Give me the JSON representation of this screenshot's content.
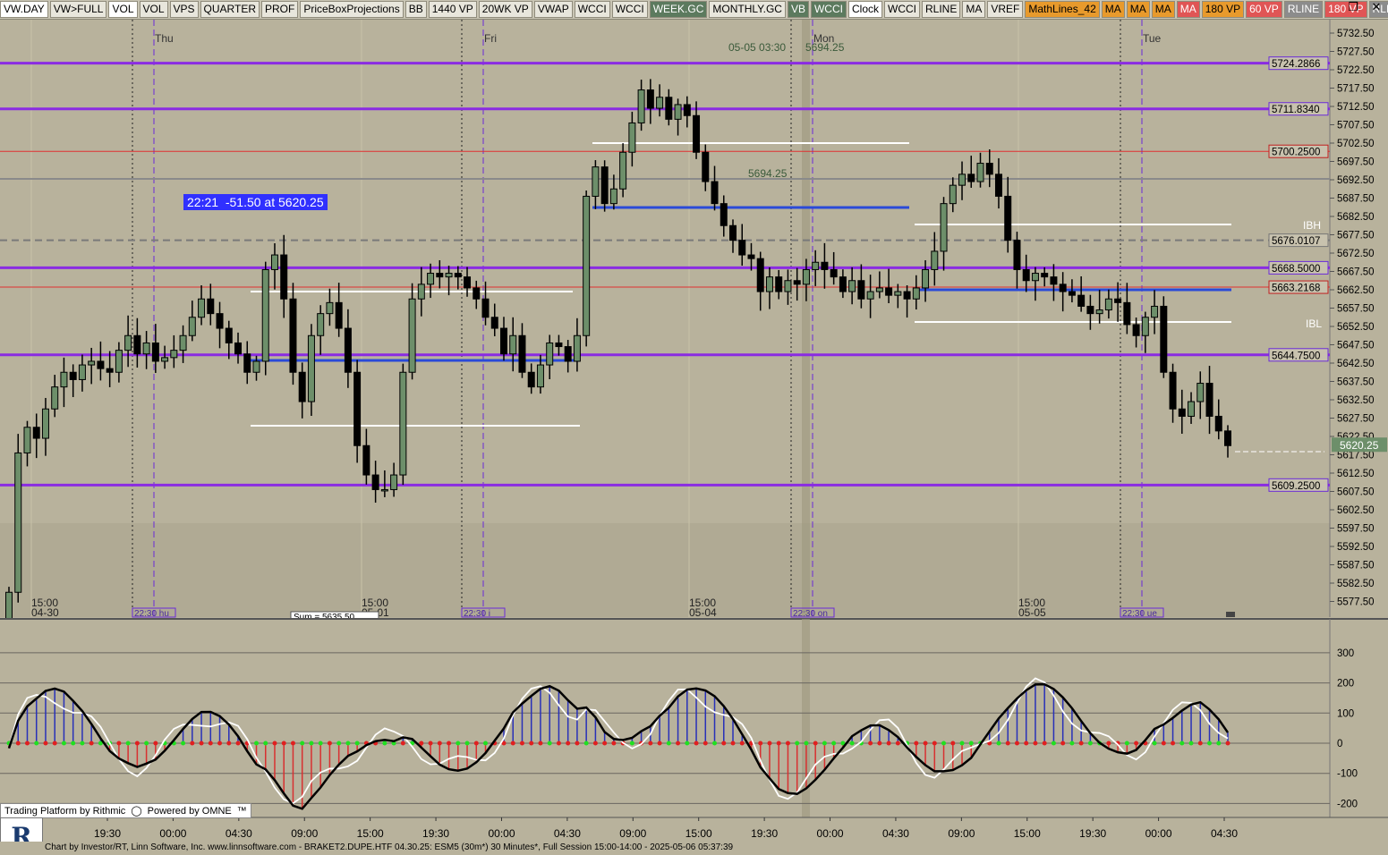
{
  "toolbar": {
    "buttons": [
      {
        "label": "VW.DAY",
        "style": "sel"
      },
      {
        "label": "VW>FULL",
        "style": ""
      },
      {
        "label": "VOL",
        "style": "sel"
      },
      {
        "label": "VOL",
        "style": ""
      },
      {
        "label": "VPS",
        "style": ""
      },
      {
        "label": "QUARTER",
        "style": ""
      },
      {
        "label": "PROF",
        "style": ""
      },
      {
        "label": "PriceBoxProjections",
        "style": ""
      },
      {
        "label": "BB",
        "style": ""
      },
      {
        "label": "1440 VP",
        "style": ""
      },
      {
        "label": "20WK VP",
        "style": ""
      },
      {
        "label": "VWAP",
        "style": ""
      },
      {
        "label": "WCCI",
        "style": ""
      },
      {
        "label": "WCCI",
        "style": ""
      },
      {
        "label": "WEEK.GC",
        "style": "dk"
      },
      {
        "label": "MONTHLY.GC",
        "style": ""
      },
      {
        "label": "VB",
        "style": "dk"
      },
      {
        "label": "WCCI",
        "style": "dk"
      },
      {
        "label": "Clock",
        "style": "sel"
      },
      {
        "label": "WCCI",
        "style": ""
      },
      {
        "label": "RLINE",
        "style": ""
      },
      {
        "label": "MA",
        "style": ""
      },
      {
        "label": "VREF",
        "style": ""
      },
      {
        "label": "MathLines_42",
        "style": "or"
      },
      {
        "label": "MA",
        "style": "or"
      },
      {
        "label": "MA",
        "style": "or"
      },
      {
        "label": "MA",
        "style": "or"
      },
      {
        "label": "MA",
        "style": "rd"
      },
      {
        "label": "180 VP",
        "style": "or"
      },
      {
        "label": "60 VP",
        "style": "rd"
      },
      {
        "label": "RLINE",
        "style": "gy"
      },
      {
        "label": "180 VP",
        "style": "rd"
      },
      {
        "label": "RLINE",
        "style": "gy"
      }
    ],
    "window_controls": [
      "restore-icon",
      "close-icon"
    ],
    "window_glyphs": [
      "❐",
      "✕"
    ]
  },
  "price_axis": {
    "min": 5577.5,
    "max": 5732.5,
    "step": 5,
    "labels": [
      "5732.50",
      "5727.50",
      "5722.50",
      "5717.50",
      "5712.50",
      "5707.50",
      "5702.50",
      "5697.50",
      "5692.50",
      "5687.50",
      "5682.50",
      "5677.50",
      "5672.50",
      "5667.50",
      "5662.50",
      "5657.50",
      "5652.50",
      "5647.50",
      "5642.50",
      "5637.50",
      "5632.50",
      "5627.50",
      "5622.50",
      "5617.50",
      "5612.50",
      "5607.50",
      "5602.50",
      "5597.50",
      "5592.50",
      "5587.50",
      "5582.50",
      "5577.50"
    ],
    "last_price": "5620.25"
  },
  "level_lines": [
    {
      "label": "5724.2866",
      "value": 5724.2866,
      "color": "#8a2be2",
      "kind": "purple"
    },
    {
      "label": "5711.8340",
      "value": 5711.834,
      "color": "#8a2be2",
      "kind": "purple"
    },
    {
      "label": "5700.2500",
      "value": 5700.25,
      "color": "#e03030",
      "kind": "red"
    },
    {
      "label": "5676.0107",
      "value": 5676.0107,
      "color": "#808080",
      "kind": "dash"
    },
    {
      "label": "5668.5000",
      "value": 5668.5,
      "color": "#8a2be2",
      "kind": "purple"
    },
    {
      "label": "5663.2168",
      "value": 5663.2168,
      "color": "#e03030",
      "kind": "red"
    },
    {
      "label": "5644.7500",
      "value": 5644.75,
      "color": "#8a2be2",
      "kind": "purple"
    },
    {
      "label": "5609.2500",
      "value": 5609.25,
      "color": "#8a2be2",
      "kind": "purple"
    }
  ],
  "session_labels": {
    "days": [
      "Thu",
      "Fri",
      "Mon",
      "Tue"
    ],
    "day_session_ticks": [
      "22:30 hu",
      "22:30 i",
      "22:30 on",
      "22:30 ue"
    ],
    "ib_high": "IBH",
    "ib_low": "IBL",
    "timestamp_label": "05-05 03:30",
    "timestamp_price": "5694.25",
    "midline_label": "5694.25",
    "hidden_box_label": "Sum = 5635.50"
  },
  "price_box": {
    "time": "22:21",
    "change": "-51.50",
    "at": "at",
    "price": "5620.25"
  },
  "date_axis": [
    {
      "time": "15:00",
      "date": "04-30"
    },
    {
      "time": "15:00",
      "date": "05-01"
    },
    {
      "time": "15:00",
      "date": "05-04"
    },
    {
      "time": "15:00",
      "date": "05-05"
    }
  ],
  "oscillator_axis": [
    "300",
    "200",
    "100",
    "0",
    "-100",
    "-200"
  ],
  "bottom_time_axis": [
    "19:30",
    "00:00",
    "04:30",
    "09:00",
    "15:00",
    "19:30",
    "00:00",
    "04:30",
    "09:00",
    "15:00",
    "19:30",
    "00:00",
    "04:30",
    "09:00",
    "15:00",
    "19:30",
    "00:00",
    "04:30"
  ],
  "footer": {
    "rithmic": "Trading Platform by Rithmic",
    "omne": "Powered by OMNE",
    "status": "Chart by Investor/RT, Linn Software, Inc. www.linnsoftware.com - BRAKET2.DUPE.HTF   04.30.25: ESM5 (30m*) 30 Minutes*, Full Session 15:00-14:00 - 2025-05-06 05:37:39",
    "logo": "R",
    "tm": "™"
  },
  "chart_data": {
    "type": "candlestick",
    "instrument": "ESM5",
    "interval": "30 Minutes",
    "candles_close": [
      5580,
      5618,
      5625,
      5622,
      5630,
      5636,
      5640,
      5638,
      5642,
      5643,
      5641,
      5640,
      5646,
      5650,
      5645,
      5648,
      5643,
      5644,
      5646,
      5650,
      5655,
      5660,
      5656,
      5652,
      5648,
      5645,
      5640,
      5643,
      5668,
      5672,
      5660,
      5640,
      5632,
      5650,
      5656,
      5659,
      5652,
      5640,
      5620,
      5612,
      5608,
      5608,
      5612,
      5640,
      5660,
      5664,
      5667,
      5666,
      5667,
      5666,
      5663,
      5660,
      5655,
      5652,
      5645,
      5650,
      5640,
      5636,
      5642,
      5648,
      5647,
      5643,
      5650,
      5688,
      5696,
      5686,
      5690,
      5700,
      5708,
      5717,
      5712,
      5715,
      5709,
      5713,
      5710,
      5700,
      5692,
      5686,
      5680,
      5676,
      5672,
      5671,
      5662,
      5666,
      5662,
      5665,
      5664,
      5668,
      5670,
      5668,
      5666,
      5662,
      5665,
      5660,
      5662,
      5663,
      5661,
      5662,
      5660,
      5663,
      5668,
      5673,
      5686,
      5691,
      5694,
      5692,
      5697,
      5694,
      5688,
      5676,
      5668,
      5665,
      5667,
      5666,
      5664,
      5662,
      5661,
      5658,
      5656,
      5657,
      5660,
      5659,
      5653,
      5650,
      5655,
      5658,
      5640,
      5630,
      5628,
      5632,
      5637,
      5628,
      5624,
      5620
    ],
    "oscillator": {
      "levels": [
        300,
        200,
        100,
        0,
        -100,
        -200
      ]
    }
  }
}
